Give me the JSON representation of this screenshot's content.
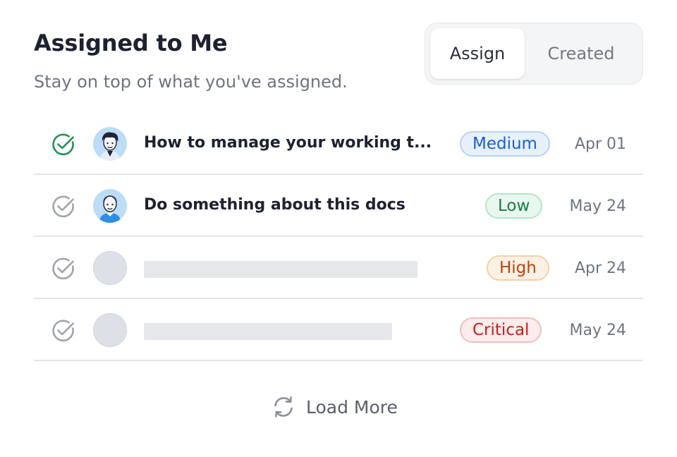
{
  "header": {
    "title": "Assigned to Me",
    "subtitle": "Stay on top of what you've assigned."
  },
  "tabs": [
    {
      "label": "Assign",
      "active": true
    },
    {
      "label": "Created",
      "active": false
    }
  ],
  "tasks": [
    {
      "title": "How to manage your working t...",
      "priority": "Medium",
      "due": "Apr 01",
      "completed": true,
      "avatar_icon": "dark-haired-man-avatar"
    },
    {
      "title": "Do something about this docs",
      "priority": "Low",
      "due": "May 24",
      "completed": false,
      "avatar_icon": "bald-man-avatar"
    },
    {
      "title": "",
      "priority": "High",
      "due": "Apr 24",
      "completed": false,
      "avatar_icon": "placeholder-avatar"
    },
    {
      "title": "",
      "priority": "Critical",
      "due": "May 24",
      "completed": false,
      "avatar_icon": "placeholder-avatar"
    }
  ],
  "load_more": {
    "label": "Load More",
    "icon": "refresh-icon"
  },
  "colors": {
    "check_completed": "#1f9255",
    "check_pending": "#a0a4ab",
    "medium": "#1e5ecf",
    "low": "#1d7a45",
    "high": "#c2410c",
    "critical": "#c81e1e"
  }
}
